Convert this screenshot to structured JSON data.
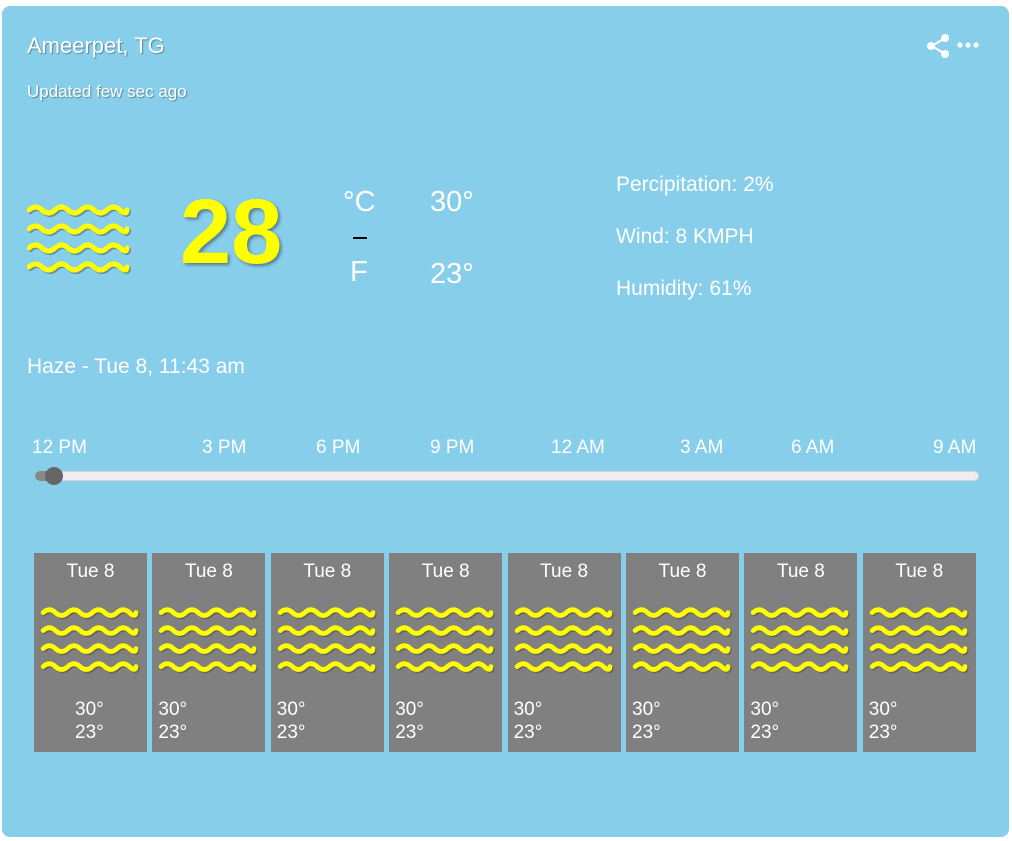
{
  "header": {
    "location": "Ameerpet, TG",
    "updated": "Updated few sec ago",
    "share_icon": "share-icon",
    "more_icon": "more-horizontal-icon"
  },
  "current": {
    "icon": "haze-icon",
    "temperature": "28",
    "unit_c": "°C",
    "unit_f": "F",
    "high": "30°",
    "low": "23°",
    "precipitation": "Percipitation: 2%",
    "wind": "Wind: 8 KMPH",
    "humidity": "Humidity: 61%",
    "condition": "Haze - Tue 8, 11:43 am"
  },
  "timeline": {
    "ticks": [
      "12 PM",
      "3 PM",
      "6 PM",
      "9 PM",
      "12 AM",
      "3 AM",
      "6 AM",
      "9 AM"
    ],
    "position": 0.02
  },
  "forecast": [
    {
      "day": "Tue 8",
      "high": "30°",
      "low": "23°",
      "icon": "haze-icon"
    },
    {
      "day": "Tue 8",
      "high": "30°",
      "low": "23°",
      "icon": "haze-icon"
    },
    {
      "day": "Tue 8",
      "high": "30°",
      "low": "23°",
      "icon": "haze-icon"
    },
    {
      "day": "Tue 8",
      "high": "30°",
      "low": "23°",
      "icon": "haze-icon"
    },
    {
      "day": "Tue 8",
      "high": "30°",
      "low": "23°",
      "icon": "haze-icon"
    },
    {
      "day": "Tue 8",
      "high": "30°",
      "low": "23°",
      "icon": "haze-icon"
    },
    {
      "day": "Tue 8",
      "high": "30°",
      "low": "23°",
      "icon": "haze-icon"
    },
    {
      "day": "Tue 8",
      "high": "30°",
      "low": "23°",
      "icon": "haze-icon"
    }
  ],
  "colors": {
    "card_background": "#87ceeb",
    "accent": "#ffff00",
    "day_tile": "#808080"
  }
}
